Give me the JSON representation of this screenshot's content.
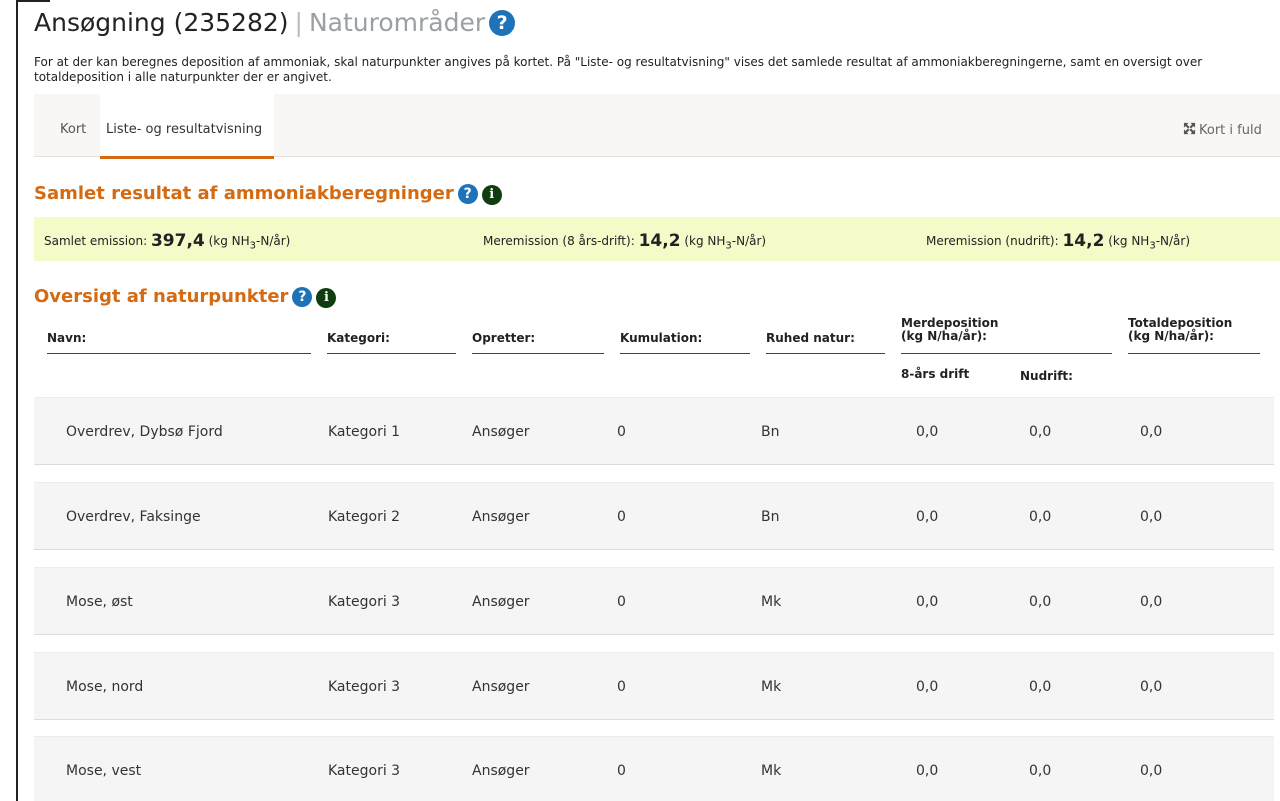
{
  "header": {
    "title": "Ansøgning (235282)",
    "separator": "|",
    "subtitle": "Naturområder",
    "help_glyph": "?"
  },
  "intro": "For at der kan beregnes deposition af ammoniak, skal naturpunkter angives på kortet. På \"Liste- og resultatvisning\" vises det samlede resultat af ammoniakberegningerne, samt en oversigt over totaldeposition i alle naturpunkter der er angivet.",
  "tabs": {
    "kort": "Kort",
    "liste": "Liste- og resultatvisning"
  },
  "fullscreen_label": "Kort i fuld",
  "results": {
    "title": "Samlet resultat af ammoniakberegninger",
    "help_glyph": "?",
    "info_glyph": "i",
    "items": [
      {
        "label": "Samlet emission:",
        "value": "397,4",
        "unit_pre": "(kg NH",
        "unit_sub": "3",
        "unit_post": "-N/år)"
      },
      {
        "label": "Meremission (8 års-drift):",
        "value": "14,2",
        "unit_pre": "(kg NH",
        "unit_sub": "3",
        "unit_post": "-N/år)"
      },
      {
        "label": "Meremission (nudrift):",
        "value": "14,2",
        "unit_pre": "(kg NH",
        "unit_sub": "3",
        "unit_post": "-N/år)"
      }
    ]
  },
  "overview": {
    "title": "Oversigt af naturpunkter",
    "help_glyph": "?",
    "info_glyph": "i",
    "headers": {
      "navn": "Navn:",
      "kategori": "Kategori:",
      "opretter": "Opretter:",
      "kumulation": "Kumulation:",
      "ruhed": "Ruhed natur:",
      "merdep_1": "Merdeposition",
      "merdep_2": "(kg N/ha/år):",
      "totaldep_1": "Totaldeposition",
      "totaldep_2": "(kg N/ha/år):",
      "sub_8aars": "8-års drift",
      "sub_nudrift": "Nudrift:"
    },
    "rows": [
      {
        "navn": "Overdrev, Dybsø Fjord",
        "kategori": "Kategori 1",
        "opretter": "Ansøger",
        "kumulation": "0",
        "ruhed": "Bn",
        "merdep_8": "0,0",
        "merdep_nu": "0,0",
        "total": "0,0"
      },
      {
        "navn": "Overdrev, Faksinge",
        "kategori": "Kategori 2",
        "opretter": "Ansøger",
        "kumulation": "0",
        "ruhed": "Bn",
        "merdep_8": "0,0",
        "merdep_nu": "0,0",
        "total": "0,0"
      },
      {
        "navn": "Mose, øst",
        "kategori": "Kategori 3",
        "opretter": "Ansøger",
        "kumulation": "0",
        "ruhed": "Mk",
        "merdep_8": "0,0",
        "merdep_nu": "0,0",
        "total": "0,0"
      },
      {
        "navn": "Mose, nord",
        "kategori": "Kategori 3",
        "opretter": "Ansøger",
        "kumulation": "0",
        "ruhed": "Mk",
        "merdep_8": "0,0",
        "merdep_nu": "0,0",
        "total": "0,0"
      },
      {
        "navn": "Mose, vest",
        "kategori": "Kategori 3",
        "opretter": "Ansøger",
        "kumulation": "0",
        "ruhed": "Mk",
        "merdep_8": "0,0",
        "merdep_nu": "0,0",
        "total": "0,0"
      }
    ]
  }
}
